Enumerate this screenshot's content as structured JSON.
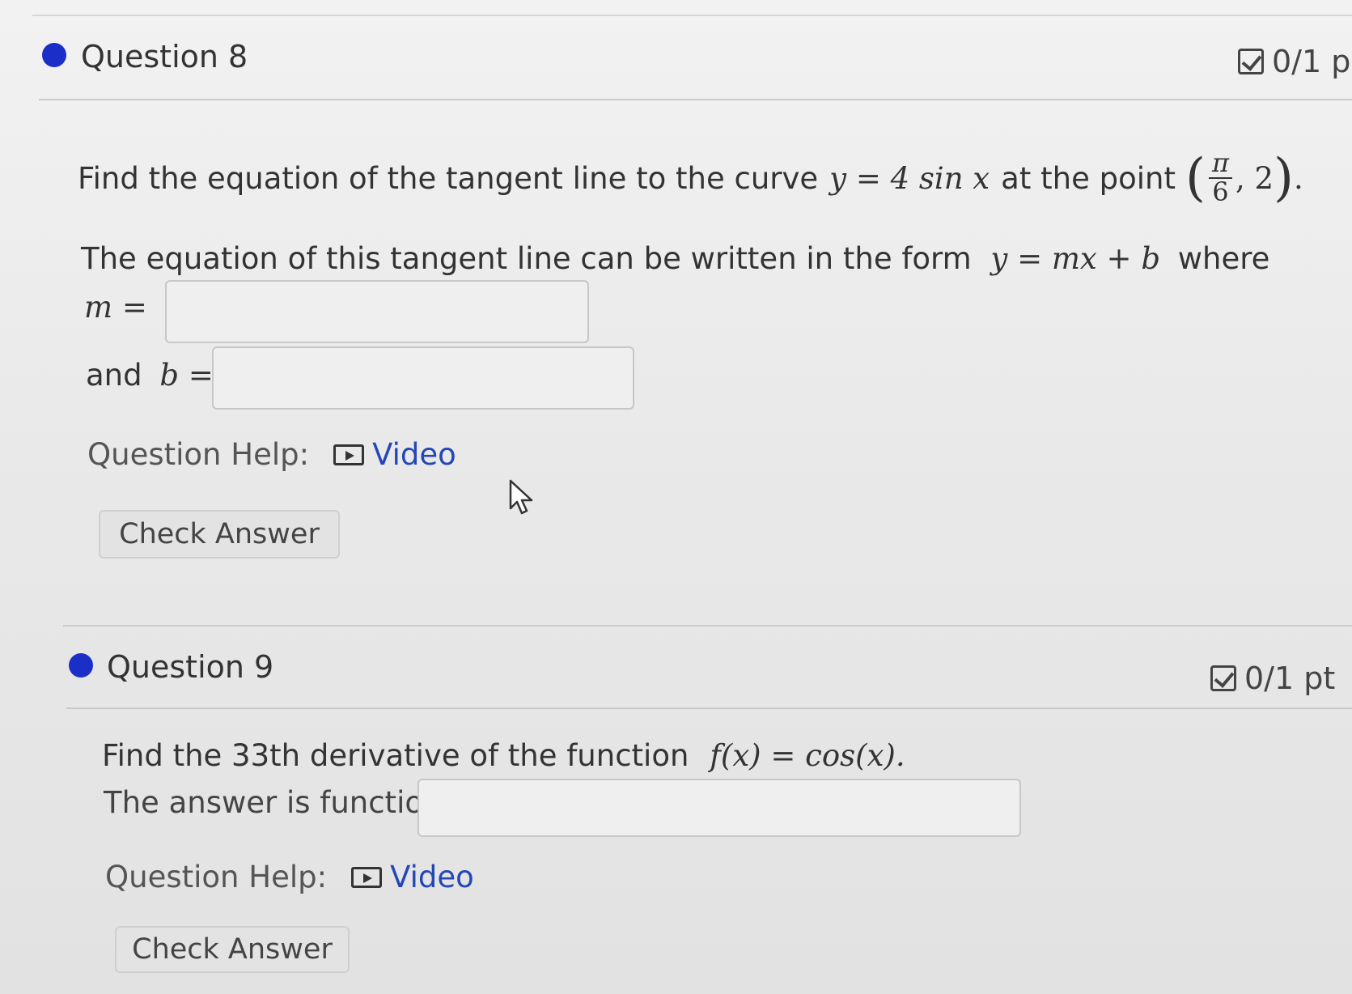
{
  "question8": {
    "title": "Question 8",
    "points": "0/1 p",
    "prompt_text": "Find the equation of the tangent line to the curve",
    "equation": "y = 4 sin x",
    "at_the_point": "at the point",
    "point_num": "π",
    "point_den": "6",
    "point_y": "2",
    "form_text": "The equation of this tangent line can be written in the form",
    "form_eq": "y = mx + b",
    "where": "where",
    "m_label": "m =",
    "and_label": "and",
    "b_label": "b =",
    "m_value": "",
    "b_value": "",
    "help_label": "Question Help:",
    "video_label": "Video",
    "check_label": "Check Answer"
  },
  "question9": {
    "title": "Question 9",
    "points": "0/1 pt",
    "prompt_text": "Find the 33th derivative of the function",
    "equation": "f(x) = cos(x).",
    "answer_label": "The answer is function",
    "answer_value": "",
    "help_label": "Question Help:",
    "video_label": "Video",
    "check_label": "Check Answer"
  },
  "colors": {
    "status_dot": "#1b2ec8",
    "link": "#2447b8"
  },
  "icons": [
    "status-dot-icon",
    "checkbox-icon",
    "video-play-icon",
    "mouse-cursor-icon"
  ]
}
